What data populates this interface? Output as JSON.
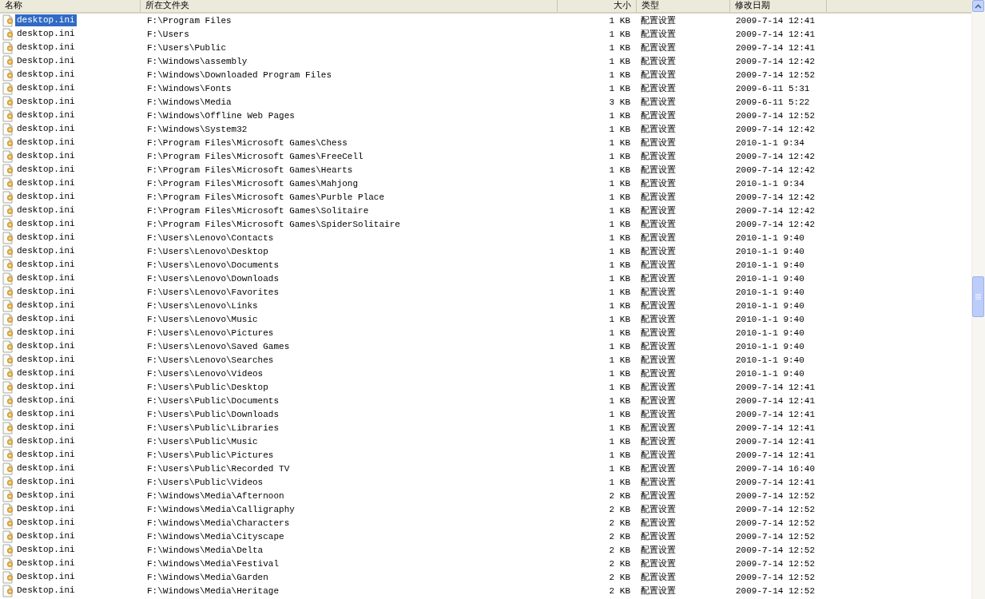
{
  "columns": [
    "名称",
    "所在文件夹",
    "大小",
    "类型",
    "修改日期"
  ],
  "rows": [
    {
      "name": "desktop.ini",
      "folder": "F:\\Program Files",
      "size": "1 KB",
      "type": "配置设置",
      "modified": "2009-7-14 12:41",
      "selected": true
    },
    {
      "name": "desktop.ini",
      "folder": "F:\\Users",
      "size": "1 KB",
      "type": "配置设置",
      "modified": "2009-7-14 12:41",
      "selected": false
    },
    {
      "name": "desktop.ini",
      "folder": "F:\\Users\\Public",
      "size": "1 KB",
      "type": "配置设置",
      "modified": "2009-7-14 12:41",
      "selected": false
    },
    {
      "name": "Desktop.ini",
      "folder": "F:\\Windows\\assembly",
      "size": "1 KB",
      "type": "配置设置",
      "modified": "2009-7-14 12:42",
      "selected": false
    },
    {
      "name": "desktop.ini",
      "folder": "F:\\Windows\\Downloaded Program Files",
      "size": "1 KB",
      "type": "配置设置",
      "modified": "2009-7-14 12:52",
      "selected": false
    },
    {
      "name": "desktop.ini",
      "folder": "F:\\Windows\\Fonts",
      "size": "1 KB",
      "type": "配置设置",
      "modified": "2009-6-11 5:31",
      "selected": false
    },
    {
      "name": "Desktop.ini",
      "folder": "F:\\Windows\\Media",
      "size": "3 KB",
      "type": "配置设置",
      "modified": "2009-6-11 5:22",
      "selected": false
    },
    {
      "name": "desktop.ini",
      "folder": "F:\\Windows\\Offline Web Pages",
      "size": "1 KB",
      "type": "配置设置",
      "modified": "2009-7-14 12:52",
      "selected": false
    },
    {
      "name": "desktop.ini",
      "folder": "F:\\Windows\\System32",
      "size": "1 KB",
      "type": "配置设置",
      "modified": "2009-7-14 12:42",
      "selected": false
    },
    {
      "name": "desktop.ini",
      "folder": "F:\\Program Files\\Microsoft Games\\Chess",
      "size": "1 KB",
      "type": "配置设置",
      "modified": "2010-1-1 9:34",
      "selected": false
    },
    {
      "name": "desktop.ini",
      "folder": "F:\\Program Files\\Microsoft Games\\FreeCell",
      "size": "1 KB",
      "type": "配置设置",
      "modified": "2009-7-14 12:42",
      "selected": false
    },
    {
      "name": "desktop.ini",
      "folder": "F:\\Program Files\\Microsoft Games\\Hearts",
      "size": "1 KB",
      "type": "配置设置",
      "modified": "2009-7-14 12:42",
      "selected": false
    },
    {
      "name": "desktop.ini",
      "folder": "F:\\Program Files\\Microsoft Games\\Mahjong",
      "size": "1 KB",
      "type": "配置设置",
      "modified": "2010-1-1 9:34",
      "selected": false
    },
    {
      "name": "desktop.ini",
      "folder": "F:\\Program Files\\Microsoft Games\\Purble Place",
      "size": "1 KB",
      "type": "配置设置",
      "modified": "2009-7-14 12:42",
      "selected": false
    },
    {
      "name": "desktop.ini",
      "folder": "F:\\Program Files\\Microsoft Games\\Solitaire",
      "size": "1 KB",
      "type": "配置设置",
      "modified": "2009-7-14 12:42",
      "selected": false
    },
    {
      "name": "desktop.ini",
      "folder": "F:\\Program Files\\Microsoft Games\\SpiderSolitaire",
      "size": "1 KB",
      "type": "配置设置",
      "modified": "2009-7-14 12:42",
      "selected": false
    },
    {
      "name": "desktop.ini",
      "folder": "F:\\Users\\Lenovo\\Contacts",
      "size": "1 KB",
      "type": "配置设置",
      "modified": "2010-1-1 9:40",
      "selected": false
    },
    {
      "name": "desktop.ini",
      "folder": "F:\\Users\\Lenovo\\Desktop",
      "size": "1 KB",
      "type": "配置设置",
      "modified": "2010-1-1 9:40",
      "selected": false
    },
    {
      "name": "desktop.ini",
      "folder": "F:\\Users\\Lenovo\\Documents",
      "size": "1 KB",
      "type": "配置设置",
      "modified": "2010-1-1 9:40",
      "selected": false
    },
    {
      "name": "desktop.ini",
      "folder": "F:\\Users\\Lenovo\\Downloads",
      "size": "1 KB",
      "type": "配置设置",
      "modified": "2010-1-1 9:40",
      "selected": false
    },
    {
      "name": "desktop.ini",
      "folder": "F:\\Users\\Lenovo\\Favorites",
      "size": "1 KB",
      "type": "配置设置",
      "modified": "2010-1-1 9:40",
      "selected": false
    },
    {
      "name": "desktop.ini",
      "folder": "F:\\Users\\Lenovo\\Links",
      "size": "1 KB",
      "type": "配置设置",
      "modified": "2010-1-1 9:40",
      "selected": false
    },
    {
      "name": "desktop.ini",
      "folder": "F:\\Users\\Lenovo\\Music",
      "size": "1 KB",
      "type": "配置设置",
      "modified": "2010-1-1 9:40",
      "selected": false
    },
    {
      "name": "desktop.ini",
      "folder": "F:\\Users\\Lenovo\\Pictures",
      "size": "1 KB",
      "type": "配置设置",
      "modified": "2010-1-1 9:40",
      "selected": false
    },
    {
      "name": "desktop.ini",
      "folder": "F:\\Users\\Lenovo\\Saved Games",
      "size": "1 KB",
      "type": "配置设置",
      "modified": "2010-1-1 9:40",
      "selected": false
    },
    {
      "name": "desktop.ini",
      "folder": "F:\\Users\\Lenovo\\Searches",
      "size": "1 KB",
      "type": "配置设置",
      "modified": "2010-1-1 9:40",
      "selected": false
    },
    {
      "name": "desktop.ini",
      "folder": "F:\\Users\\Lenovo\\Videos",
      "size": "1 KB",
      "type": "配置设置",
      "modified": "2010-1-1 9:40",
      "selected": false
    },
    {
      "name": "desktop.ini",
      "folder": "F:\\Users\\Public\\Desktop",
      "size": "1 KB",
      "type": "配置设置",
      "modified": "2009-7-14 12:41",
      "selected": false
    },
    {
      "name": "desktop.ini",
      "folder": "F:\\Users\\Public\\Documents",
      "size": "1 KB",
      "type": "配置设置",
      "modified": "2009-7-14 12:41",
      "selected": false
    },
    {
      "name": "desktop.ini",
      "folder": "F:\\Users\\Public\\Downloads",
      "size": "1 KB",
      "type": "配置设置",
      "modified": "2009-7-14 12:41",
      "selected": false
    },
    {
      "name": "desktop.ini",
      "folder": "F:\\Users\\Public\\Libraries",
      "size": "1 KB",
      "type": "配置设置",
      "modified": "2009-7-14 12:41",
      "selected": false
    },
    {
      "name": "desktop.ini",
      "folder": "F:\\Users\\Public\\Music",
      "size": "1 KB",
      "type": "配置设置",
      "modified": "2009-7-14 12:41",
      "selected": false
    },
    {
      "name": "desktop.ini",
      "folder": "F:\\Users\\Public\\Pictures",
      "size": "1 KB",
      "type": "配置设置",
      "modified": "2009-7-14 12:41",
      "selected": false
    },
    {
      "name": "desktop.ini",
      "folder": "F:\\Users\\Public\\Recorded TV",
      "size": "1 KB",
      "type": "配置设置",
      "modified": "2009-7-14 16:40",
      "selected": false
    },
    {
      "name": "desktop.ini",
      "folder": "F:\\Users\\Public\\Videos",
      "size": "1 KB",
      "type": "配置设置",
      "modified": "2009-7-14 12:41",
      "selected": false
    },
    {
      "name": "Desktop.ini",
      "folder": "F:\\Windows\\Media\\Afternoon",
      "size": "2 KB",
      "type": "配置设置",
      "modified": "2009-7-14 12:52",
      "selected": false
    },
    {
      "name": "Desktop.ini",
      "folder": "F:\\Windows\\Media\\Calligraphy",
      "size": "2 KB",
      "type": "配置设置",
      "modified": "2009-7-14 12:52",
      "selected": false
    },
    {
      "name": "Desktop.ini",
      "folder": "F:\\Windows\\Media\\Characters",
      "size": "2 KB",
      "type": "配置设置",
      "modified": "2009-7-14 12:52",
      "selected": false
    },
    {
      "name": "Desktop.ini",
      "folder": "F:\\Windows\\Media\\Cityscape",
      "size": "2 KB",
      "type": "配置设置",
      "modified": "2009-7-14 12:52",
      "selected": false
    },
    {
      "name": "Desktop.ini",
      "folder": "F:\\Windows\\Media\\Delta",
      "size": "2 KB",
      "type": "配置设置",
      "modified": "2009-7-14 12:52",
      "selected": false
    },
    {
      "name": "Desktop.ini",
      "folder": "F:\\Windows\\Media\\Festival",
      "size": "2 KB",
      "type": "配置设置",
      "modified": "2009-7-14 12:52",
      "selected": false
    },
    {
      "name": "Desktop.ini",
      "folder": "F:\\Windows\\Media\\Garden",
      "size": "2 KB",
      "type": "配置设置",
      "modified": "2009-7-14 12:52",
      "selected": false
    },
    {
      "name": "Desktop.ini",
      "folder": "F:\\Windows\\Media\\Heritage",
      "size": "2 KB",
      "type": "配置设置",
      "modified": "2009-7-14 12:52",
      "selected": false
    }
  ]
}
